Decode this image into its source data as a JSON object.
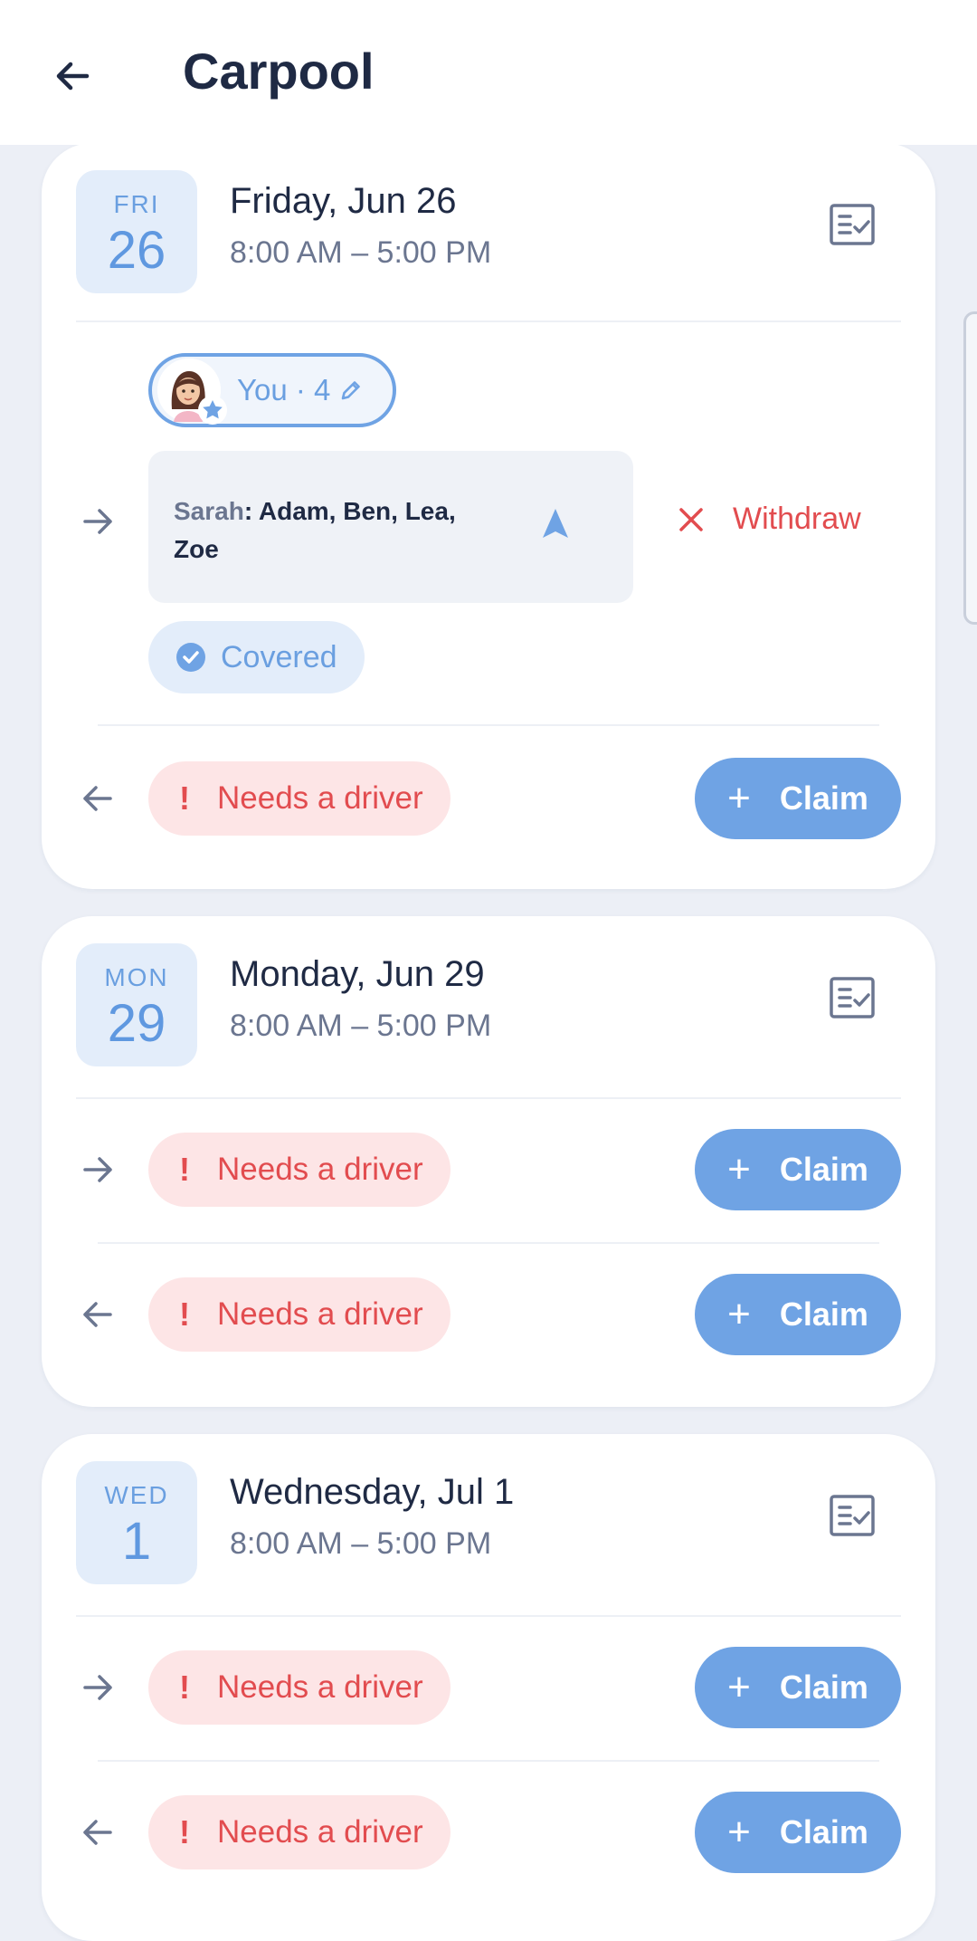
{
  "header": {
    "title": "Carpool",
    "back_icon": "arrow-left-icon"
  },
  "days": [
    {
      "dow": "FRI",
      "day": "26",
      "title": "Friday, Jun 26",
      "time": "8:00 AM – 5:00 PM",
      "to_school": {
        "you_label": "You · 4",
        "driver": "Sarah",
        "kids": ": Adam, Ben, Lea, Zoe",
        "withdraw_label": "Withdraw",
        "covered_label": "Covered"
      },
      "from_school": {
        "status": "Needs a driver",
        "claim_label": "Claim"
      }
    },
    {
      "dow": "MON",
      "day": "29",
      "title": "Monday, Jun 29",
      "time": "8:00 AM – 5:00 PM",
      "to_school": {
        "status": "Needs a driver",
        "claim_label": "Claim"
      },
      "from_school": {
        "status": "Needs a driver",
        "claim_label": "Claim"
      }
    },
    {
      "dow": "WED",
      "day": "1",
      "title": "Wednesday, Jul 1",
      "time": "8:00 AM – 5:00 PM",
      "to_school": {
        "status": "Needs a driver",
        "claim_label": "Claim"
      },
      "from_school": {
        "status": "Needs a driver",
        "claim_label": "Claim"
      }
    }
  ],
  "colors": {
    "accent": "#6fa3e4",
    "danger": "#e24c4f",
    "danger_bg": "#fde5e6",
    "covered_bg": "#e3edfa"
  }
}
